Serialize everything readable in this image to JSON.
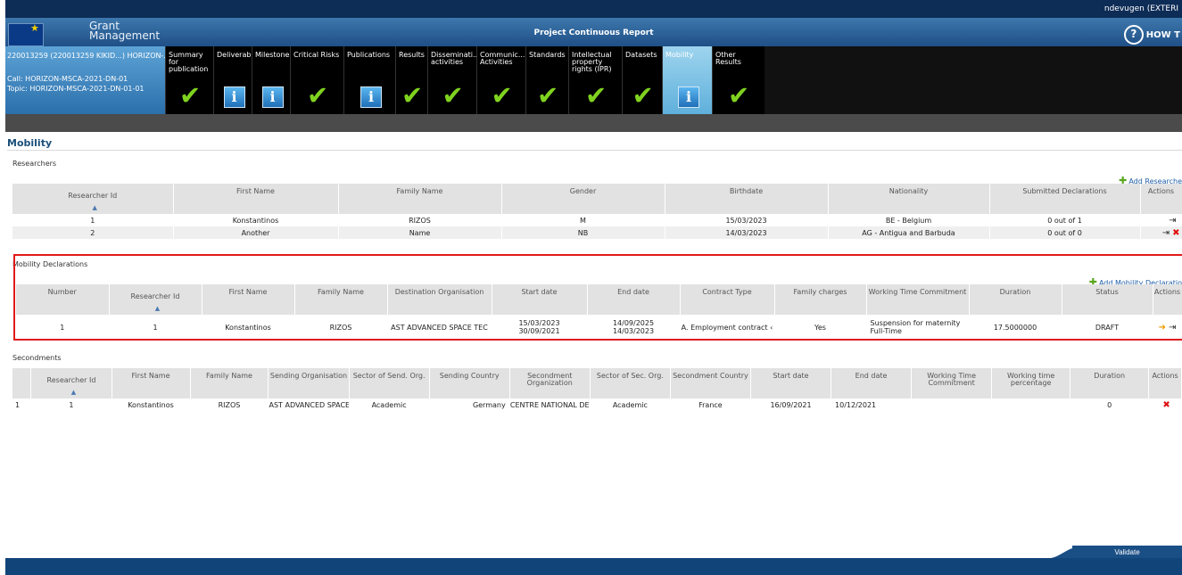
{
  "header": {
    "user": "ndevugen (EXTERI",
    "app_name_line1": "Grant",
    "app_name_line2": "Management",
    "title": "Project Continuous Report",
    "help": "HOW T"
  },
  "project": {
    "id_line": "220013259 (220013259 KIKID...)   HORIZON-...",
    "call": "Call: HORIZON-MSCA-2021-DN-01",
    "topic": "Topic: HORIZON-MSCA-2021-DN-01-01"
  },
  "tabs": [
    {
      "label": "Summary for\npublication",
      "icon": "check",
      "active": false
    },
    {
      "label": "Deliverables",
      "icon": "info",
      "active": false
    },
    {
      "label": "Milestones",
      "icon": "info",
      "active": false
    },
    {
      "label": "Critical Risks",
      "icon": "check",
      "active": false
    },
    {
      "label": "Publications",
      "icon": "info",
      "active": false
    },
    {
      "label": "Results",
      "icon": "check",
      "active": false
    },
    {
      "label": "Disseminati...\nactivities",
      "icon": "check",
      "active": false
    },
    {
      "label": "Communic...\nActivities",
      "icon": "check",
      "active": false
    },
    {
      "label": "Standards",
      "icon": "check",
      "active": false
    },
    {
      "label": "Intellectual\nproperty\nrights (IPR)",
      "icon": "check",
      "active": false
    },
    {
      "label": "Datasets",
      "icon": "check",
      "active": false
    },
    {
      "label": "Mobility",
      "icon": "info",
      "active": true
    },
    {
      "label": "Other\nResults",
      "icon": "check",
      "active": false
    }
  ],
  "page_title": "Mobility",
  "researchers": {
    "label": "Researchers",
    "add_label": "Add Researche",
    "columns": [
      "Researcher Id",
      "First Name",
      "Family Name",
      "Gender",
      "Birthdate",
      "Nationality",
      "Submitted Declarations",
      "Actions"
    ],
    "rows": [
      {
        "id": "1",
        "first": "Konstantinos",
        "family": "RIZOS",
        "gender": "M",
        "birthdate": "15/03/2023",
        "nationality": "BE - Belgium",
        "declarations": "0 out of 1"
      },
      {
        "id": "2",
        "first": "Another",
        "family": "Name",
        "gender": "NB",
        "birthdate": "14/03/2023",
        "nationality": "AG - Antigua and Barbuda",
        "declarations": "0 out of 0"
      }
    ]
  },
  "declarations": {
    "label": "Mobility Declarations",
    "add_label": "Add Mobility Declaratio",
    "columns": [
      "Number",
      "Researcher Id",
      "First Name",
      "Family Name",
      "Destination Organisation",
      "Start date",
      "End date",
      "Contract Type",
      "Family charges",
      "Working Time Commitment",
      "Duration",
      "Status",
      "Actions"
    ],
    "rows": [
      {
        "number": "1",
        "researcher_id": "1",
        "first": "Konstantinos",
        "family": "RIZOS",
        "destination": "AST ADVANCED SPACE TEC",
        "start1": "15/03/2023",
        "start2": "30/09/2021",
        "end1": "14/09/2025",
        "end2": "14/03/2023",
        "contract": "A. Employment contract ‹",
        "family_charges": "Yes",
        "wtc1": "Suspension for maternity",
        "wtc2": "Full-Time",
        "duration": "17.5000000",
        "status": "DRAFT"
      }
    ]
  },
  "secondments": {
    "label": "Secondments",
    "columns": [
      "",
      "Researcher Id",
      "First Name",
      "Family Name",
      "Sending Organisation",
      "Sector of Send. Org.",
      "Sending Country",
      "Secondment\nOrganization",
      "Sector of Sec. Org.",
      "Secondment Country",
      "Start date",
      "End date",
      "Working Time\nCommitment",
      "Working time\npercentage",
      "Duration",
      "Actions"
    ],
    "rows": [
      {
        "index": "1",
        "researcher_id": "1",
        "first": "Konstantinos",
        "family": "RIZOS",
        "sending_org": "AST ADVANCED SPACE",
        "sector_send": "Academic",
        "sending_country": "Germany",
        "sec_org": "CENTRE NATIONAL DE",
        "sector_sec": "Academic",
        "sec_country": "France",
        "start": "16/09/2021",
        "end": "10/12/2021",
        "wtc": "",
        "wtp": "",
        "duration": "0"
      }
    ]
  },
  "footer": {
    "validate": "Validate"
  }
}
